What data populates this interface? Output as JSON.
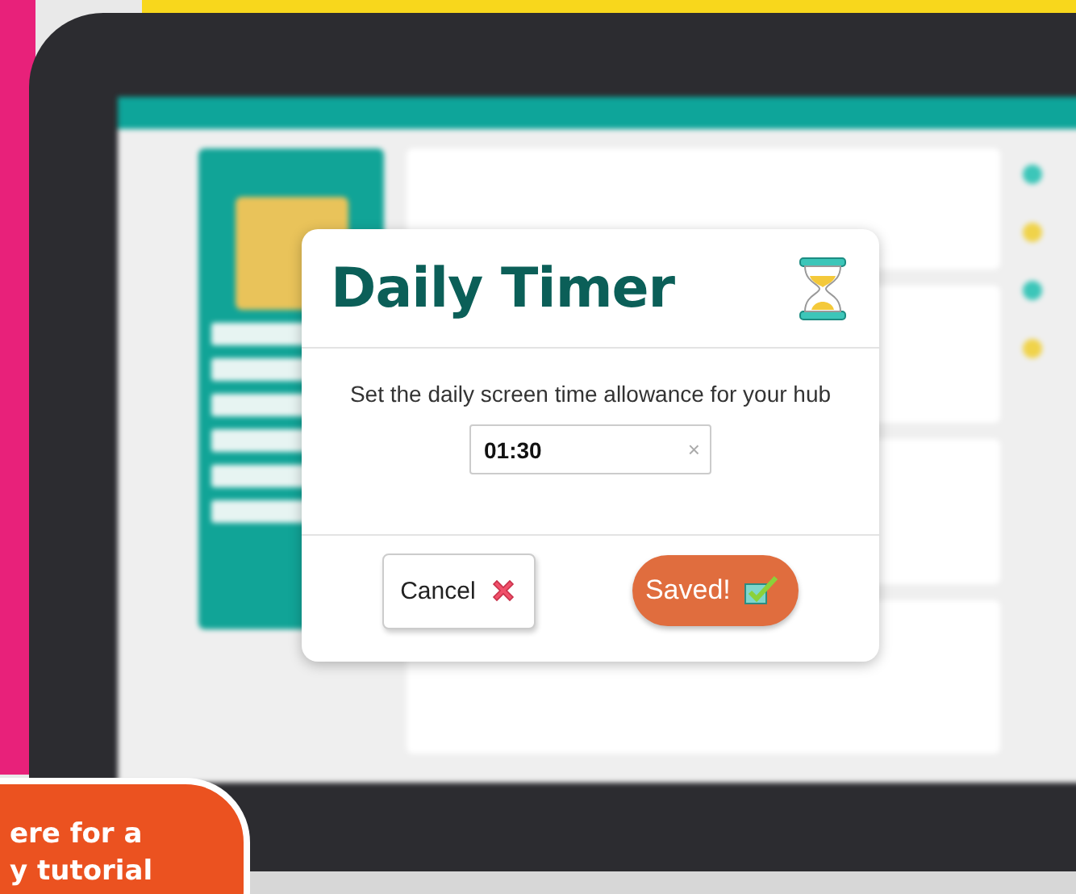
{
  "dialog": {
    "title": "Daily Timer",
    "description": "Set the daily screen time allowance for your hub",
    "time_field": {
      "value": "01:30",
      "clear": "×"
    },
    "buttons": [
      {
        "kind": "cancel",
        "label": "Cancel"
      },
      {
        "kind": "save",
        "label": "Saved!"
      }
    ]
  },
  "banner": {
    "lines": [
      "ere for a",
      "y tutorial"
    ]
  }
}
